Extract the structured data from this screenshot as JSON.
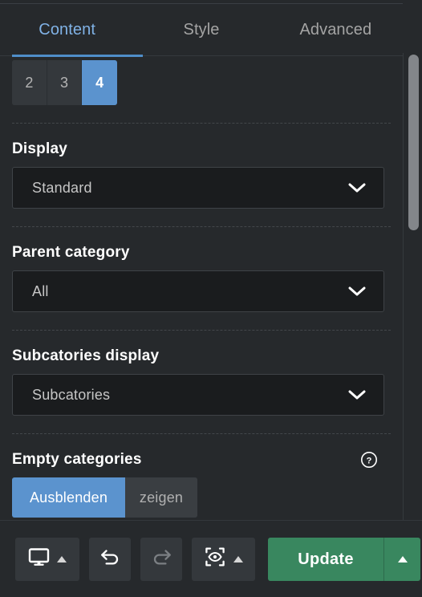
{
  "panel": {
    "tabs": [
      {
        "label": "Content",
        "active": true
      },
      {
        "label": "Style",
        "active": false
      },
      {
        "label": "Advanced",
        "active": false
      }
    ],
    "accent_color": "#5b93ce",
    "update_color": "#39875f",
    "background_color": "#26292c"
  },
  "columns_control": {
    "options": [
      "2",
      "3",
      "4"
    ],
    "selected": "4"
  },
  "controls": [
    {
      "label": "Display",
      "value": "Standard",
      "icon": "chevron-down-icon"
    },
    {
      "label": "Parent category",
      "value": "All",
      "icon": "chevron-down-icon"
    },
    {
      "label": "Subcatories display",
      "value": "Subcatories",
      "icon": "chevron-down-icon"
    }
  ],
  "empty_categories": {
    "label": "Empty categories",
    "help_icon": "help-circle-icon",
    "options": [
      {
        "label": "Ausblenden",
        "active": true
      },
      {
        "label": "zeigen",
        "active": false
      }
    ]
  },
  "bottom_bar": {
    "responsive_mode": {
      "icon": "desktop-monitor-icon",
      "caret": "caret-up-icon"
    },
    "undo": {
      "icon": "undo-arrow-icon"
    },
    "redo": {
      "icon": "redo-arrow-icon"
    },
    "preview_changes": {
      "icon": "preview-eye-icon",
      "caret": "caret-up-icon"
    },
    "update": {
      "label": "Update",
      "caret": "caret-up-icon"
    }
  },
  "scrollbar": {
    "orientation": "vertical"
  }
}
